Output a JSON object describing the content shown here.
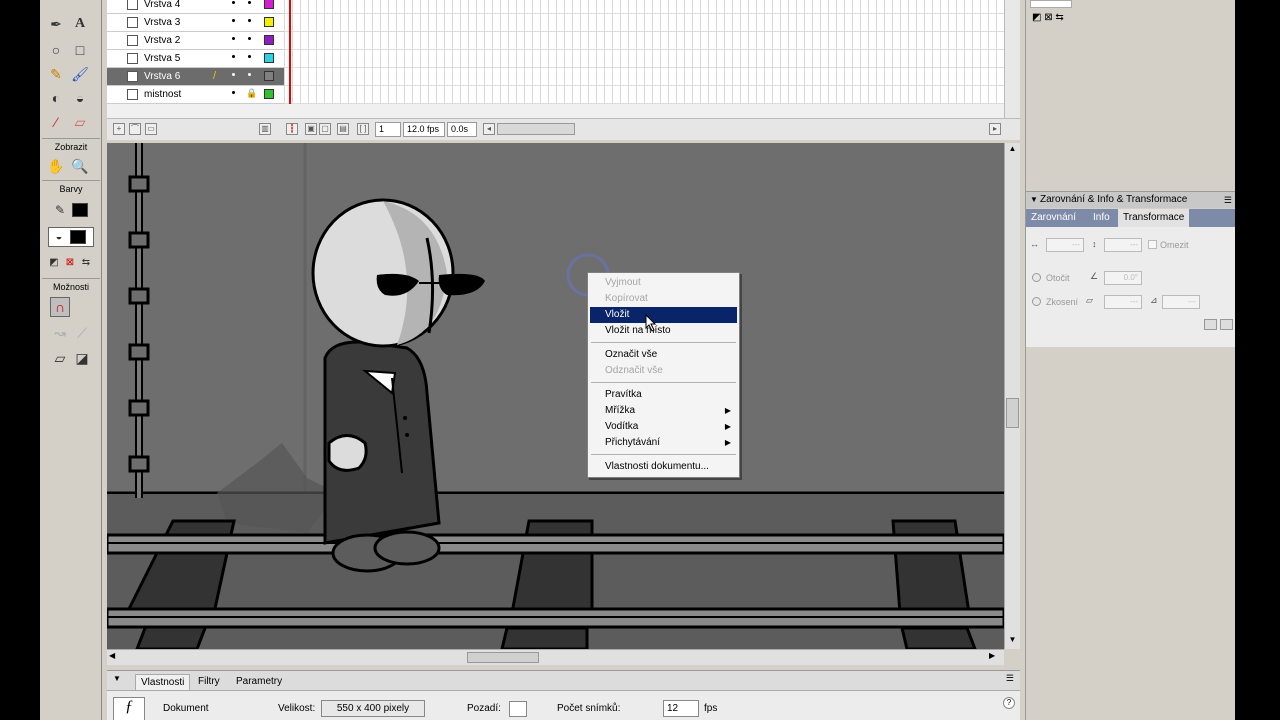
{
  "toolbox": {
    "label_view": "Zobrazit",
    "label_colors": "Barvy",
    "label_options": "Možnosti",
    "tool_text_glyph": "A",
    "stroke_color": "#000000",
    "fill_color": "#000000"
  },
  "timeline": {
    "layers": [
      {
        "name": "Vrstva 4",
        "color": "#d020d0",
        "selected": false
      },
      {
        "name": "Vrstva 3",
        "color": "#f0f000",
        "selected": false
      },
      {
        "name": "Vrstva 2",
        "color": "#9020c0",
        "selected": false
      },
      {
        "name": "Vrstva 5",
        "color": "#30d0e0",
        "selected": false
      },
      {
        "name": "Vrstva 6",
        "color": "#808080",
        "selected": true
      },
      {
        "name": "mistnost",
        "color": "#30c030",
        "selected": false
      }
    ],
    "frame_number": "1",
    "fps": "12.0 fps",
    "elapsed": "0.0s"
  },
  "context_menu": {
    "items": [
      {
        "label": "Vyjmout",
        "disabled": true
      },
      {
        "label": "Kopírovat",
        "disabled": true
      },
      {
        "label": "Vložit",
        "highlighted": true
      },
      {
        "label": "Vložit na místo"
      },
      {
        "label": "Označit vše"
      },
      {
        "label": "Odznačit vše",
        "disabled": true
      },
      {
        "label": "Pravítka"
      },
      {
        "label": "Mřížka",
        "submenu": true
      },
      {
        "label": "Vodítka",
        "submenu": true
      },
      {
        "label": "Přichytávání",
        "submenu": true
      },
      {
        "label": "Vlastnosti dokumentu..."
      }
    ]
  },
  "right_panel": {
    "header": "Zarovnání & Info & Transformace",
    "tabs": [
      "Zarovnání",
      "Info",
      "Transformace"
    ],
    "active_tab": "Transformace",
    "constrain_label": "Omezit",
    "rotate_label": "Otočit",
    "rotate_value": "0.0°",
    "skew_label": "Zkosení"
  },
  "properties": {
    "tabs": [
      "Vlastnosti",
      "Filtry",
      "Parametry"
    ],
    "active_tab": "Vlastnosti",
    "doc_label": "Dokument",
    "size_label": "Velikost:",
    "size_value": "550 x 400 pixely",
    "bg_label": "Pozadí:",
    "frame_rate_label": "Počet snímků:",
    "frame_rate_value": "12",
    "fps_unit": "fps"
  }
}
